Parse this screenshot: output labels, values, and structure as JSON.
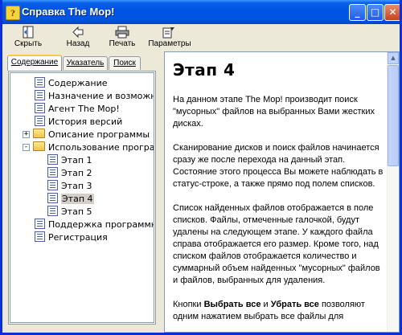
{
  "window": {
    "title": "Справка The Mop!"
  },
  "toolbar": {
    "hide_label": "Скрыть",
    "back_label": "Назад",
    "print_label": "Печать",
    "params_label": "Параметры"
  },
  "tabs": [
    {
      "label": "Содержание",
      "active": true
    },
    {
      "label": "Указатель",
      "active": false
    },
    {
      "label": "Поиск",
      "active": false
    }
  ],
  "tree": [
    {
      "label": "Содержание",
      "icon": "page-icon",
      "level": 1
    },
    {
      "label": "Назначение и возможнос",
      "icon": "page-icon",
      "level": 1
    },
    {
      "label": "Агент The Mop!",
      "icon": "page-icon",
      "level": 1
    },
    {
      "label": "История версий",
      "icon": "page-icon",
      "level": 1
    },
    {
      "label": "Описание программы",
      "icon": "folder-closed-icon",
      "level": 1,
      "expander": "+"
    },
    {
      "label": "Использование программ",
      "icon": "folder-open-icon",
      "level": 1,
      "expander": "-"
    },
    {
      "label": "Этап 1",
      "icon": "page-icon",
      "level": 2
    },
    {
      "label": "Этап 2",
      "icon": "page-icon",
      "level": 2
    },
    {
      "label": "Этап 3",
      "icon": "page-icon",
      "level": 2
    },
    {
      "label": "Этап 4",
      "icon": "page-icon",
      "level": 2,
      "selected": true
    },
    {
      "label": "Этап 5",
      "icon": "page-icon",
      "level": 2
    },
    {
      "label": "Поддержка программного",
      "icon": "page-icon",
      "level": 1
    },
    {
      "label": "Регистрация",
      "icon": "page-icon",
      "level": 1
    }
  ],
  "article": {
    "heading": "Этап 4",
    "p1": "На данном этапе The Mop! производит поиск \"мусорных\" файлов на выбранных Вами жестких дисках.",
    "p2": "Сканирование дисков и поиск файлов начинается сразу же после перехода на данный этап. Состояние этого процесса Вы можете наблюдать в статус-строке, а также прямо под полем списков.",
    "p3": "Список найденных файлов отображается в поле списков. Файлы, отмеченные галочкой, будут удалены на следующем этапе. У каждого файла справа отображается его размер. Кроме того, над списком файлов отображается количество и суммарный объем найденных \"мусорных\" файлов и файлов, выбранных для удаления.",
    "p4_start": "Кнопки ",
    "p4_bold1": "Выбрать все",
    "p4_mid": " и ",
    "p4_bold2": "Убрать все",
    "p4_end": " позволяют одним нажатием выбрать все файлы для"
  },
  "colors": {
    "titlebar": "#0054e3",
    "frame": "#0831d9",
    "face": "#ece9d8",
    "selected": "#d4d0c8",
    "tab_highlight": "#ffc83c"
  }
}
